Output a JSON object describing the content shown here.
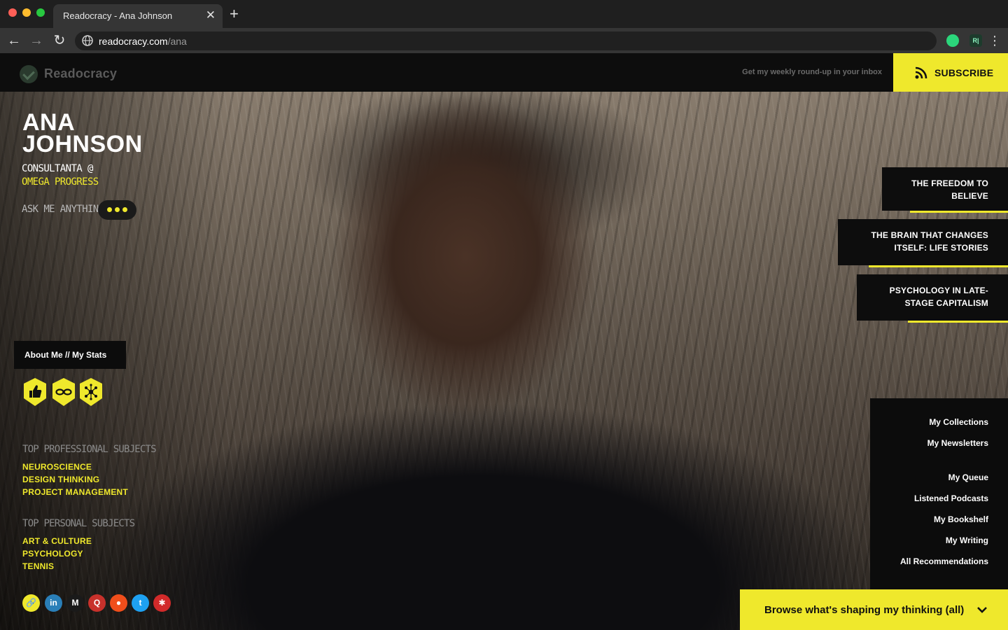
{
  "browser": {
    "tab_title": "Readocracy - Ana Johnson",
    "tab_close": "✕",
    "new_tab": "+",
    "url_host": "readocracy.com",
    "url_path": "/ana",
    "ext_label": "R|",
    "menu": "⋮",
    "back": "←",
    "forward": "→",
    "reload": "↻"
  },
  "header": {
    "logo_text": "Readocracy",
    "weekly_text": "Get my weekly round-up in your inbox",
    "subscribe_label": "SUBSCRIBE"
  },
  "profile": {
    "name_line1": "ANA",
    "name_line2": "JOHNSON",
    "role": "CONSULTANTA @",
    "org": "OMEGA PROGRESS",
    "ask_label": "ASK ME ANYTHING",
    "about_label": "About Me // My Stats",
    "badges": [
      "thumbs-up",
      "infinity",
      "network"
    ]
  },
  "subjects": {
    "professional_heading": "TOP PROFESSIONAL SUBJECTS",
    "professional": [
      "NEUROSCIENCE",
      "DESIGN THINKING",
      "PROJECT MANAGEMENT"
    ],
    "personal_heading": "TOP PERSONAL SUBJECTS",
    "personal": [
      "ART & CULTURE",
      "PSYCHOLOGY",
      "TENNIS"
    ]
  },
  "social": [
    {
      "name": "link",
      "glyph": "🔗",
      "color": "#efe82c"
    },
    {
      "name": "linkedin",
      "glyph": "in",
      "color": "#2a7fb8"
    },
    {
      "name": "medium",
      "glyph": "M",
      "color": "#1a1a1a"
    },
    {
      "name": "quora",
      "glyph": "Q",
      "color": "#c8312b"
    },
    {
      "name": "reddit",
      "glyph": "●",
      "color": "#f04e1b"
    },
    {
      "name": "twitter",
      "glyph": "t",
      "color": "#1ea1f2"
    },
    {
      "name": "yelp",
      "glyph": "✱",
      "color": "#d22a2a"
    }
  ],
  "cards": {
    "c1_l1": "THE FREEDOM TO",
    "c1_l2": "BELIEVE",
    "c2_l1": "THE BRAIN THAT CHANGES",
    "c2_l2": "ITSELF: LIFE STORIES",
    "c3_l1": "PSYCHOLOGY IN LATE-",
    "c3_l2": "STAGE CAPITALISM"
  },
  "menu": {
    "collections": "My Collections",
    "newsletters": "My Newsletters",
    "queue": "My Queue",
    "podcasts": "Listened Podcasts",
    "bookshelf": "My Bookshelf",
    "writing": "My Writing",
    "recommendations": "All Recommendations"
  },
  "browse_label": "Browse what's shaping my thinking (all)",
  "colors": {
    "accent": "#efe82c",
    "panel": "#0d0d0d"
  }
}
